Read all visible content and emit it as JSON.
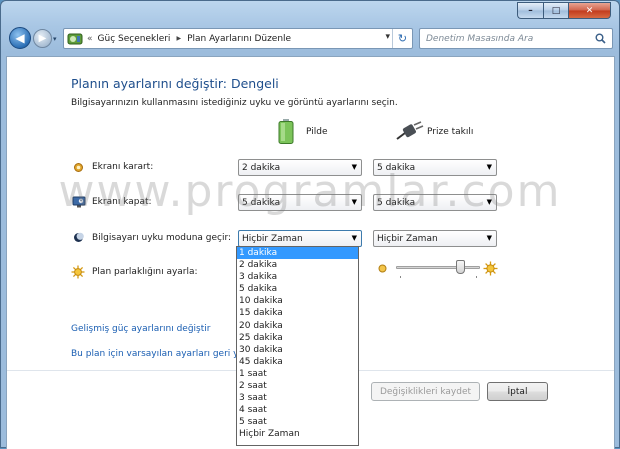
{
  "window": {
    "minimize_glyph": "–",
    "maximize_glyph": "□",
    "close_glyph": "✕"
  },
  "address_bar": {
    "separator": "«",
    "breadcrumb": [
      "Güç Seçenekleri",
      "Plan Ayarlarını Düzenle"
    ],
    "crumb_arrow": "▶",
    "dropdown_glyph": "▾",
    "refresh_glyph": "↻"
  },
  "search": {
    "placeholder": "Denetim Masasında Ara"
  },
  "page": {
    "title": "Planın ayarlarını değiştir: Dengeli",
    "subtitle": "Bilgisayarınızın kullanmasını istediğiniz uyku ve görüntü ayarlarını seçin."
  },
  "columns": {
    "battery": "Pilde",
    "plugged": "Prize takılı"
  },
  "settings": {
    "dim_display": {
      "label": "Ekranı karart:",
      "battery": "2 dakika",
      "plugged": "5 dakika"
    },
    "turn_off_display": {
      "label": "Ekranı kapat:",
      "battery": "5 dakika",
      "plugged": "5 dakika"
    },
    "sleep": {
      "label": "Bilgisayarı uyku moduna geçir:",
      "battery": "Hiçbir Zaman",
      "plugged": "Hiçbir Zaman"
    },
    "brightness": {
      "label": "Plan parlaklığını ayarla:",
      "level_fraction": 0.8
    }
  },
  "sleep_options": [
    "1 dakika",
    "2 dakika",
    "3 dakika",
    "5 dakika",
    "10 dakika",
    "15 dakika",
    "20 dakika",
    "25 dakika",
    "30 dakika",
    "45 dakika",
    "1 saat",
    "2 saat",
    "3 saat",
    "4 saat",
    "5 saat",
    "Hiçbir Zaman"
  ],
  "selected_option_index": 0,
  "links": {
    "advanced": "Gelişmiş güç ayarlarını değiştir",
    "restore": "Bu plan için varsayılan ayarları geri yük"
  },
  "buttons": {
    "save": "Değişiklikleri kaydet",
    "cancel": "İptal"
  },
  "watermark": "www.programlar.com",
  "colors": {
    "link": "#1a5eb2",
    "title": "#1e4e8c",
    "selection": "#3399ff"
  }
}
